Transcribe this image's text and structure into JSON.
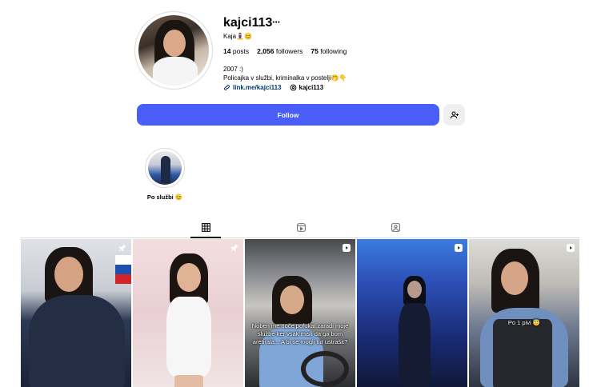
{
  "profile": {
    "username": "kajci113",
    "more": "···",
    "full_name": "Kaja🧘‍♀️😊",
    "stats": {
      "posts_count": "14",
      "posts_label": "posts",
      "followers_count": "2,056",
      "followers_label": "followers",
      "following_count": "75",
      "following_label": "following"
    },
    "bio_line1": "2007 :)",
    "bio_line2": "Policajka v službi, kriminalka v postelji🤭👇",
    "link_text": "link.me/kajci113",
    "threads_handle": "kajci113"
  },
  "actions": {
    "follow_label": "Follow"
  },
  "highlights": [
    {
      "label": "Po službi 😊"
    }
  ],
  "tabs": [
    {
      "name": "posts",
      "icon": "grid-icon",
      "active": true
    },
    {
      "name": "reels",
      "icon": "reels-icon",
      "active": false
    },
    {
      "name": "tagged",
      "icon": "tagged-icon",
      "active": false
    }
  ],
  "posts": [
    {
      "icon": "pin-icon",
      "caption": ""
    },
    {
      "icon": "pin-icon",
      "caption": ""
    },
    {
      "icon": "reel-icon",
      "caption": "Noben me noče pofukat zaradi moje službe ker vsak misli da ga bom aretirala... A bi se mogli tut ustrašit?"
    },
    {
      "icon": "reel-icon",
      "caption": ""
    },
    {
      "icon": "reel-icon",
      "caption": "Po 1 pivi 😇"
    }
  ],
  "colors": {
    "follow_button": "#4a5df9",
    "link": "#00376b"
  }
}
